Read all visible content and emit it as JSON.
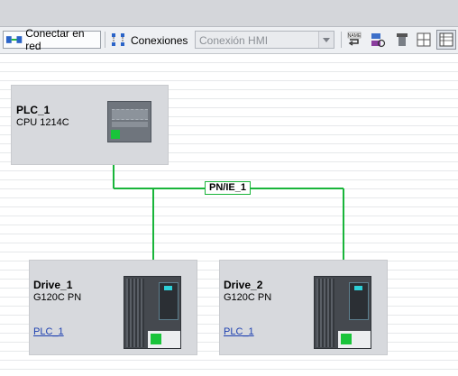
{
  "toolbar": {
    "connect_network_label": "Conectar en red",
    "connections_label": "Conexiones",
    "connection_type": {
      "selected": "Conexión HMI"
    }
  },
  "network": {
    "subnet_label": "PN/IE_1",
    "line_color": "#19b53a"
  },
  "devices": {
    "plc": {
      "name": "PLC_1",
      "type": "CPU 1214C"
    },
    "drive1": {
      "name": "Drive_1",
      "type": "G120C PN",
      "controller_link": "PLC_1"
    },
    "drive2": {
      "name": "Drive_2",
      "type": "G120C PN",
      "controller_link": "PLC_1"
    }
  },
  "colors": {
    "port_green": "#19c43a",
    "link_blue": "#1c3fb0"
  }
}
